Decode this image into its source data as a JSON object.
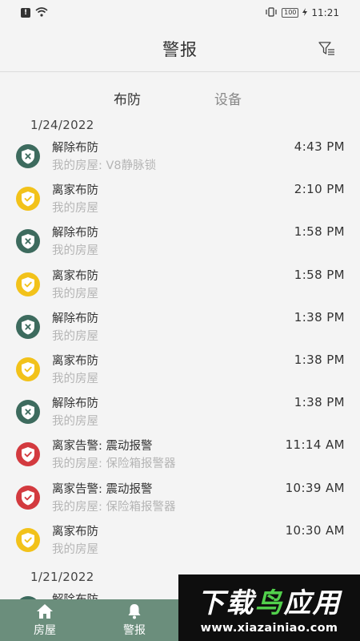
{
  "status_bar": {
    "time": "11:21",
    "battery": "100"
  },
  "header": {
    "title": "警报"
  },
  "tabs": [
    {
      "label": "布防",
      "active": true
    },
    {
      "label": "设备",
      "active": false
    }
  ],
  "groups": [
    {
      "date": "1/24/2022",
      "items": [
        {
          "type": "disarm",
          "title": "解除布防",
          "subtitle": "我的房屋: V8静脉锁",
          "time": "4:43 PM"
        },
        {
          "type": "away",
          "title": "离家布防",
          "subtitle": "我的房屋",
          "time": "2:10 PM"
        },
        {
          "type": "disarm",
          "title": "解除布防",
          "subtitle": "我的房屋",
          "time": "1:58 PM"
        },
        {
          "type": "away",
          "title": "离家布防",
          "subtitle": "我的房屋",
          "time": "1:58 PM"
        },
        {
          "type": "disarm",
          "title": "解除布防",
          "subtitle": "我的房屋",
          "time": "1:38 PM"
        },
        {
          "type": "away",
          "title": "离家布防",
          "subtitle": "我的房屋",
          "time": "1:38 PM"
        },
        {
          "type": "disarm",
          "title": "解除布防",
          "subtitle": "我的房屋",
          "time": "1:38 PM"
        },
        {
          "type": "alarm",
          "title": "离家告警: 震动报警",
          "subtitle": "我的房屋: 保险箱报警器",
          "time": "11:14 AM"
        },
        {
          "type": "alarm",
          "title": "离家告警: 震动报警",
          "subtitle": "我的房屋: 保险箱报警器",
          "time": "10:39 AM"
        },
        {
          "type": "away",
          "title": "离家布防",
          "subtitle": "我的房屋",
          "time": "10:30 AM"
        }
      ]
    },
    {
      "date": "1/21/2022",
      "items": [
        {
          "type": "disarm",
          "title": "解除布防",
          "subtitle": "",
          "time": ""
        }
      ]
    }
  ],
  "bottom_nav": [
    {
      "label": "房屋",
      "icon": "home-icon",
      "active": false
    },
    {
      "label": "警报",
      "icon": "bell-icon",
      "active": true
    }
  ],
  "watermark": {
    "brand_white": "下载",
    "brand_green": "鸟",
    "brand_white2": "应用",
    "url": "www.xiazainiao.com"
  },
  "colors": {
    "disarm": "#3d6b5e",
    "away": "#f2c21a",
    "alarm": "#d33a3f",
    "nav_bg": "#6b8e7c"
  }
}
